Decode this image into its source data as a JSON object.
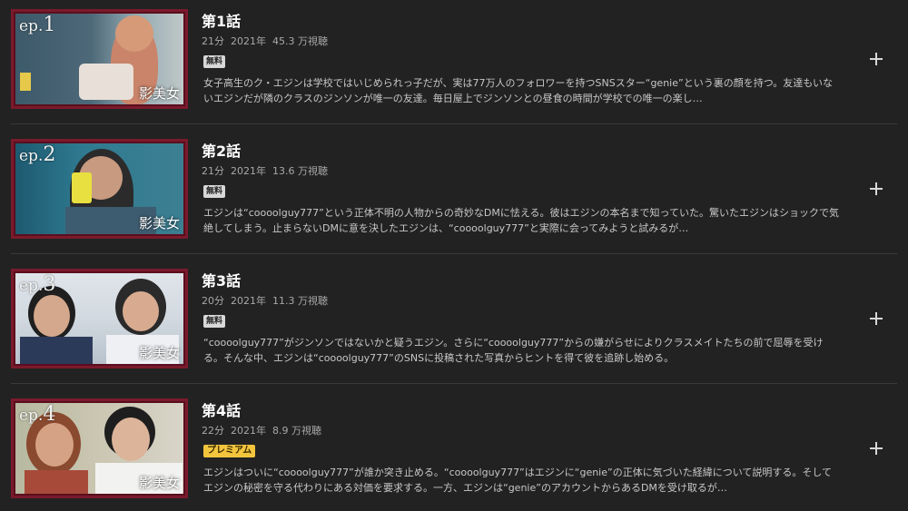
{
  "episodes": [
    {
      "ep_prefix": "ep.",
      "ep_number": "1",
      "logo": "影美女",
      "title": "第1話",
      "duration": "21分",
      "year": "2021年",
      "views": "45.3 万視聴",
      "badge": "無料",
      "badge_type": "free",
      "description": "女子高生のク・エジンは学校ではいじめられっ子だが、実は77万人のフォロワーを持つSNSスター“genie”という裏の顔を持つ。友達もいないエジンだが隣のクラスのジンソンが唯一の友達。毎日屋上でジンソンとの昼食の時間が学校での唯一の楽し…"
    },
    {
      "ep_prefix": "ep.",
      "ep_number": "2",
      "logo": "影美女",
      "title": "第2話",
      "duration": "21分",
      "year": "2021年",
      "views": "13.6 万視聴",
      "badge": "無料",
      "badge_type": "free",
      "description": "エジンは“coooolguy777”という正体不明の人物からの奇妙なDMに怯える。彼はエジンの本名まで知っていた。驚いたエジンはショックで気絶してしまう。止まらないDMに意を決したエジンは、“coooolguy777”と実際に会ってみようと試みるが…"
    },
    {
      "ep_prefix": "ep.",
      "ep_number": "3",
      "logo": "影美女",
      "title": "第3話",
      "duration": "20分",
      "year": "2021年",
      "views": "11.3 万視聴",
      "badge": "無料",
      "badge_type": "free",
      "description": "“coooolguy777”がジンソンではないかと疑うエジン。さらに“coooolguy777”からの嫌がらせによりクラスメイトたちの前で屈辱を受ける。そんな中、エジンは“coooolguy777”のSNSに投稿された写真からヒントを得て彼を追跡し始める。"
    },
    {
      "ep_prefix": "ep.",
      "ep_number": "4",
      "logo": "影美女",
      "title": "第4話",
      "duration": "22分",
      "year": "2021年",
      "views": "8.9 万視聴",
      "badge": "プレミアム",
      "badge_type": "premium",
      "description": "エジンはついに“coooolguy777”が誰か突き止める。“coooolguy777”はエジンに“genie”の正体に気づいた経緯について説明する。そしてエジンの秘密を守る代わりにある対価を要求する。一方、エジンは“genie”のアカウントからあるDMを受け取るが…"
    }
  ],
  "icons": {
    "add": "plus-icon"
  },
  "colors": {
    "background": "#222222",
    "thumb_border": "#7a1a2c",
    "free_badge": "#d8d8d8",
    "premium_badge": "#f2c53d"
  }
}
